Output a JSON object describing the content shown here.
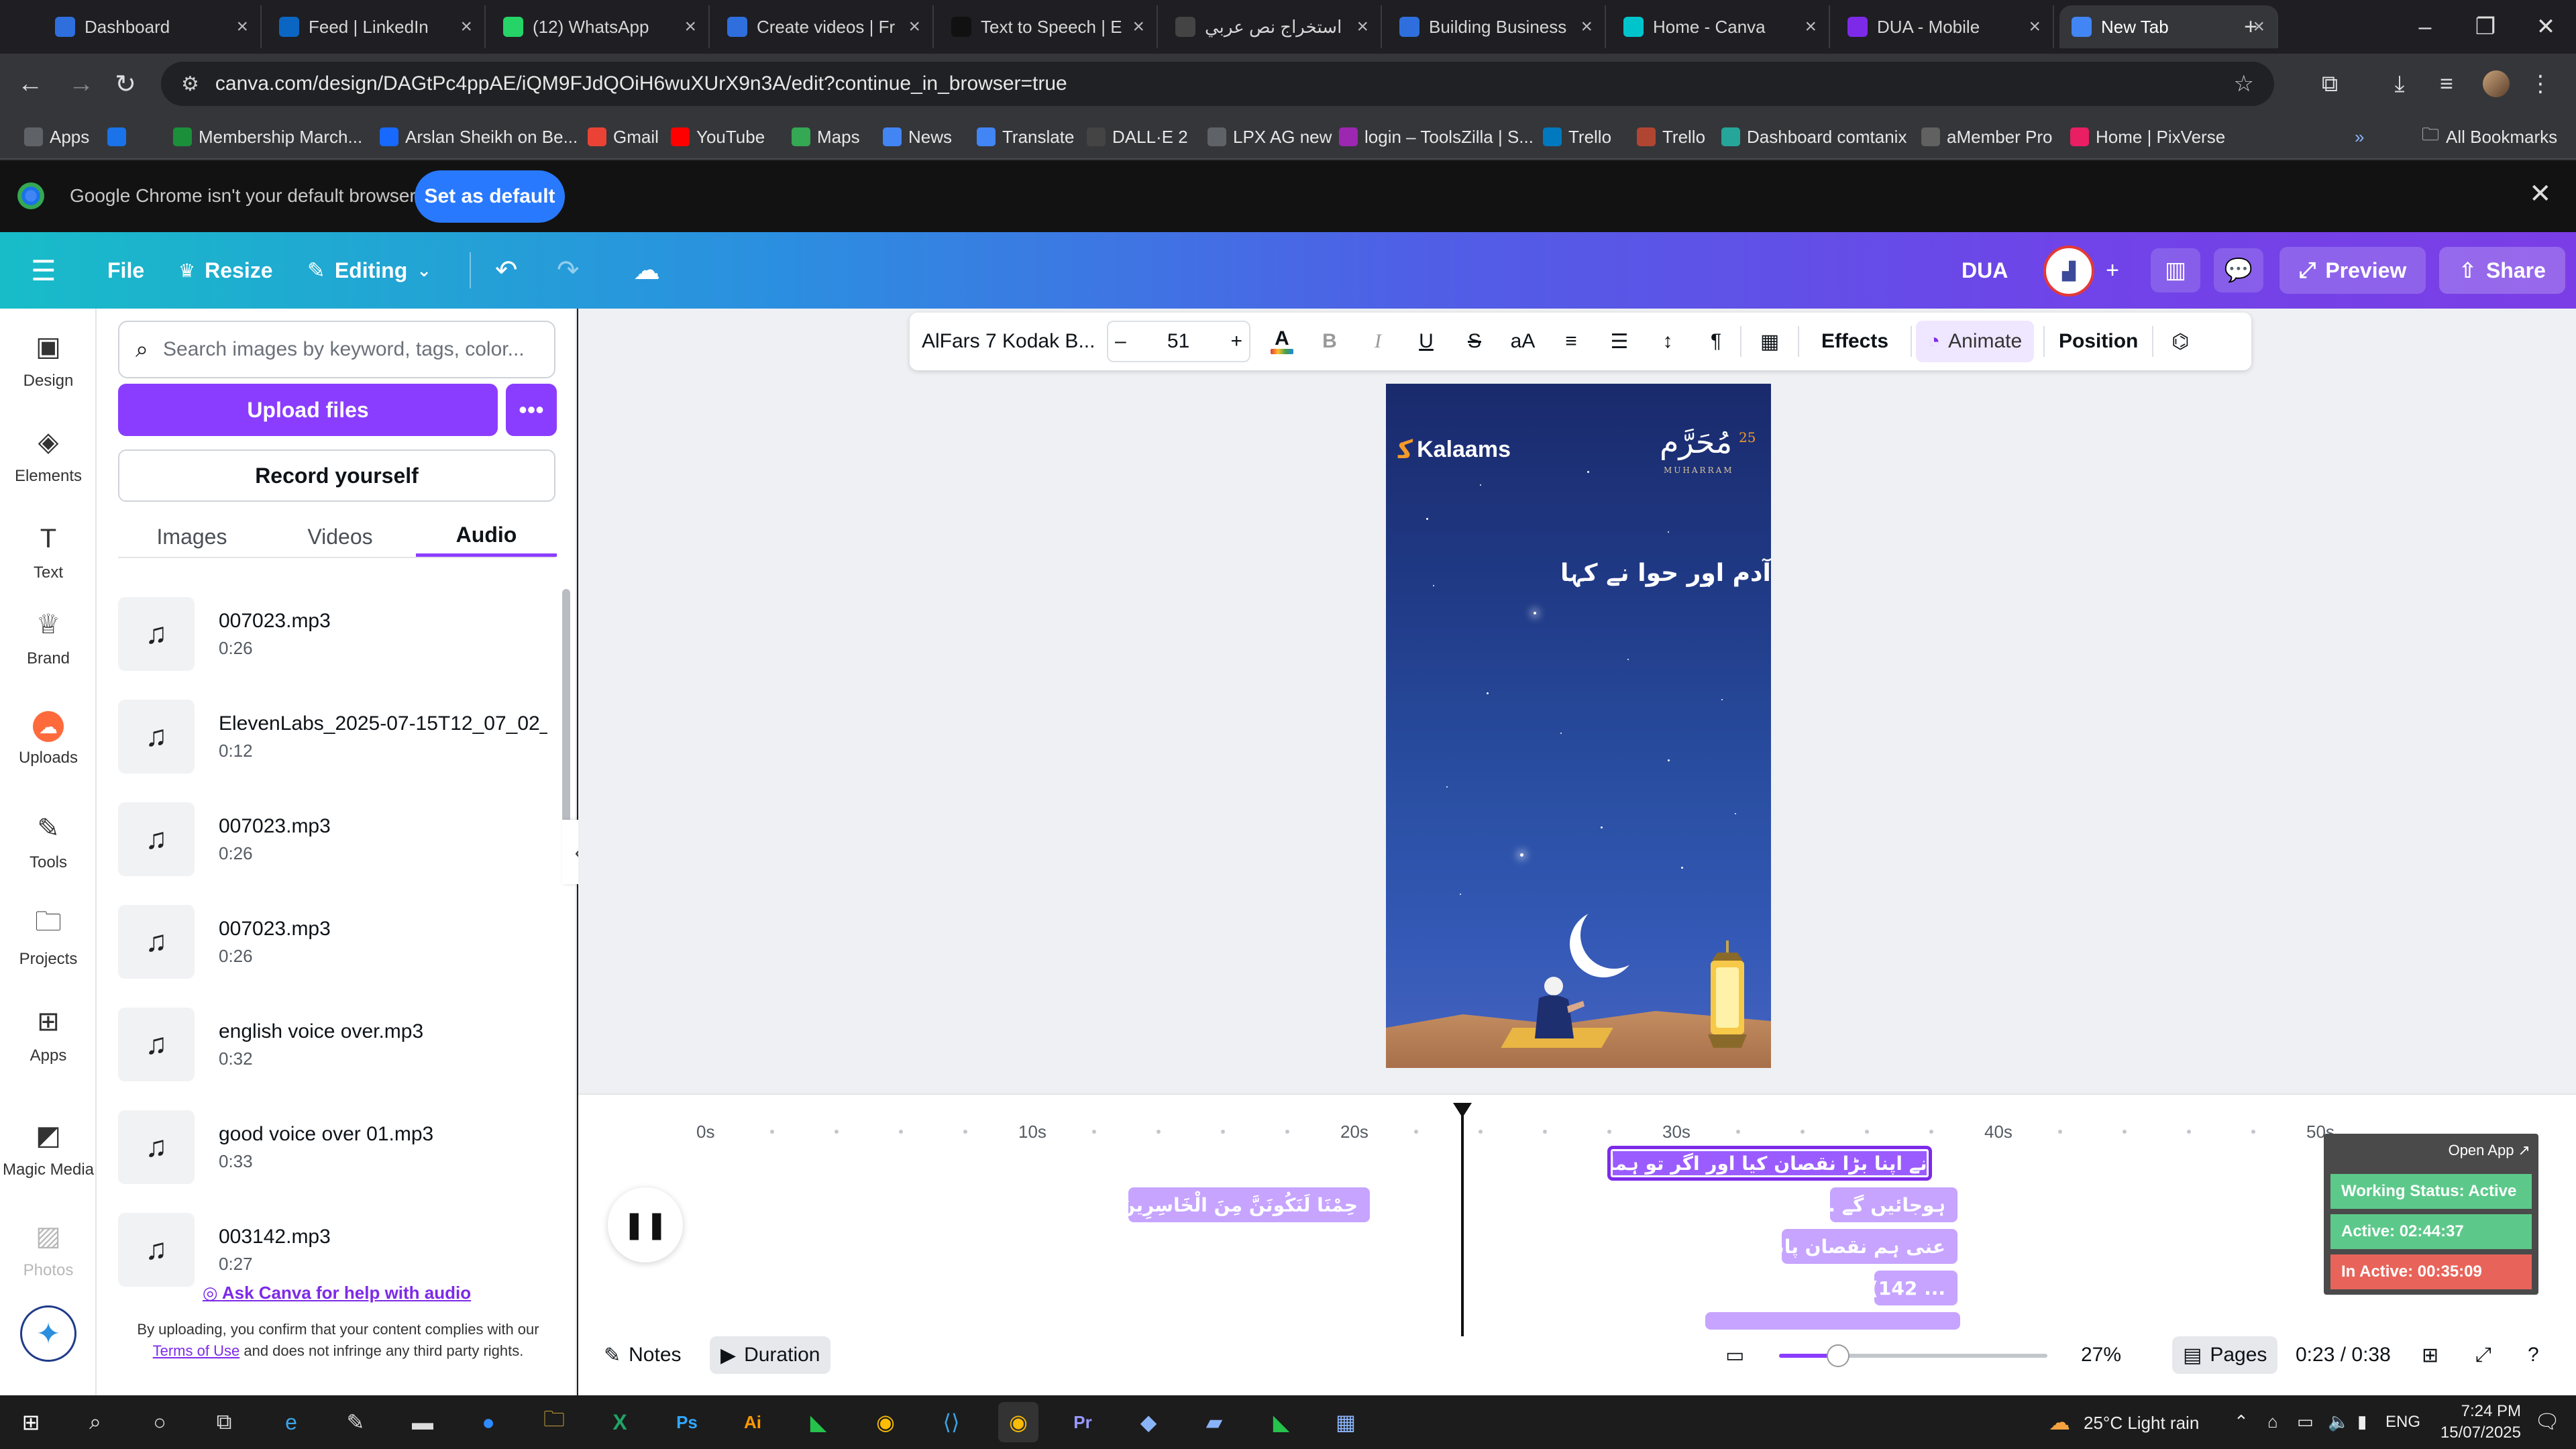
{
  "browser": {
    "tabs": [
      {
        "title": "Dashboard",
        "favicon": "dashboard-icon",
        "color": "#2f6fdd"
      },
      {
        "title": "Feed | LinkedIn",
        "favicon": "linkedin-icon",
        "color": "#0a66c2"
      },
      {
        "title": "(12) WhatsApp",
        "favicon": "whatsapp-icon",
        "color": "#25d366"
      },
      {
        "title": "Create videos | Fr",
        "favicon": "doc-icon",
        "color": "#2f6fdd"
      },
      {
        "title": "Text to Speech | E",
        "favicon": "pause-icon",
        "color": "#111111"
      },
      {
        "title": "استخراج نص عربي",
        "favicon": "openai-icon",
        "color": "#444444"
      },
      {
        "title": "Building Business",
        "favicon": "doc-icon",
        "color": "#2f6fdd"
      },
      {
        "title": "Home - Canva",
        "favicon": "canva-icon",
        "color": "#00c4cc"
      },
      {
        "title": "DUA - Mobile",
        "favicon": "canva-video-icon",
        "color": "#7d2ae8"
      },
      {
        "title": "New Tab",
        "favicon": "chrome-icon",
        "color": "#4285f4"
      }
    ],
    "new_tab_symbol": "+",
    "url": "canva.com/design/DAGtPc4ppAE/iQM9FJdQOiH6wuXUrX9n3A/edit?continue_in_browser=true",
    "bookmarks": [
      {
        "label": "Apps",
        "icon": "apps-grid-icon",
        "color": "#5f6368"
      },
      {
        "label": "",
        "icon": "grid-icon",
        "color": "#1a73e8"
      },
      {
        "label": "Membership March...",
        "icon": "membership-icon",
        "color": "#1b8f3a"
      },
      {
        "label": "Arslan Sheikh on Be...",
        "icon": "behance-icon",
        "color": "#1769ff"
      },
      {
        "label": "Gmail",
        "icon": "gmail-icon",
        "color": "#ea4335"
      },
      {
        "label": "YouTube",
        "icon": "youtube-icon",
        "color": "#ff0000"
      },
      {
        "label": "Maps",
        "icon": "maps-icon",
        "color": "#34a853"
      },
      {
        "label": "News",
        "icon": "news-icon",
        "color": "#4285f4"
      },
      {
        "label": "Translate",
        "icon": "translate-icon",
        "color": "#4285f4"
      },
      {
        "label": "DALL·E 2",
        "icon": "openai-icon",
        "color": "#444444"
      },
      {
        "label": "LPX AG new",
        "icon": "page-icon",
        "color": "#5f6368"
      },
      {
        "label": "login – ToolsZilla | S...",
        "icon": "toolszilla-icon",
        "color": "#9c27b0"
      },
      {
        "label": "Trello",
        "icon": "trello-icon",
        "color": "#0079bf"
      },
      {
        "label": "Trello",
        "icon": "trello-icon",
        "color": "#b04632"
      },
      {
        "label": "Dashboard comtanix",
        "icon": "comtanix-icon",
        "color": "#26a69a"
      },
      {
        "label": "aMember Pro",
        "icon": "amember-icon",
        "color": "#616161"
      },
      {
        "label": "Home | PixVerse",
        "icon": "pixverse-icon",
        "color": "#e91e63"
      }
    ],
    "all_bookmarks": "All Bookmarks",
    "default_msg": "Google Chrome isn't your default browser",
    "set_default": "Set as default"
  },
  "canva_header": {
    "file": "File",
    "resize": "Resize",
    "editing": "Editing",
    "design_title": "DUA",
    "preview": "Preview",
    "share": "Share"
  },
  "rail": [
    {
      "label": "Design",
      "icon": "design-layout-icon"
    },
    {
      "label": "Elements",
      "icon": "elements-shapes-icon"
    },
    {
      "label": "Text",
      "icon": "text-t-icon"
    },
    {
      "label": "Brand",
      "icon": "brand-crown-icon"
    },
    {
      "label": "Uploads",
      "icon": "uploads-cloud-icon"
    },
    {
      "label": "Tools",
      "icon": "tools-pen-icon"
    },
    {
      "label": "Projects",
      "icon": "projects-folder-icon"
    },
    {
      "label": "Apps",
      "icon": "apps-plus-icon"
    },
    {
      "label": "Magic Media",
      "icon": "magic-media-icon"
    },
    {
      "label": "Photos",
      "icon": "photos-icon"
    }
  ],
  "uploads": {
    "search_placeholder": "Search images by keyword, tags, color...",
    "upload_files": "Upload files",
    "more_symbol": "•••",
    "record_yourself": "Record yourself",
    "tabs": [
      "Images",
      "Videos",
      "Audio"
    ],
    "active_tab": "Audio",
    "audio_items": [
      {
        "name": "007023.mp3",
        "duration": "0:26"
      },
      {
        "name": "ElevenLabs_2025-07-15T12_07_02_...",
        "duration": "0:12"
      },
      {
        "name": "007023.mp3",
        "duration": "0:26"
      },
      {
        "name": "007023.mp3",
        "duration": "0:26"
      },
      {
        "name": "english voice over.mp3",
        "duration": "0:32"
      },
      {
        "name": "good voice over 01.mp3",
        "duration": "0:33"
      },
      {
        "name": "003142.mp3",
        "duration": "0:27"
      }
    ],
    "help_link": "Ask Canva for help with audio",
    "disclaimer_a": "By uploading, you confirm that your content complies with our",
    "terms": "Terms of Use",
    "disclaimer_b": "and does not infringe any third party rights."
  },
  "toolbar": {
    "font": "AlFars 7 Kodak B...",
    "minus": "–",
    "font_size": "51",
    "plus": "+",
    "letter_a": "A",
    "bold": "B",
    "italic": "I",
    "underline": "U",
    "strike": "S",
    "case": "aA",
    "effects": "Effects",
    "animate": "Animate",
    "position": "Position"
  },
  "design": {
    "logo_text": "Kalaams",
    "muharram": "مُحَرَّم",
    "muharram_num": "25",
    "muharram_sub": "MUHARRAM",
    "urdu_text": "آدم اور حوا نے کہا"
  },
  "timeline": {
    "ticks": [
      "0s",
      "10s",
      "20s",
      "30s",
      "40s",
      "50s"
    ],
    "clips": [
      {
        "text": "...حِمْنَا لَنَكُونَنَّ مِنَ الْخَاسِرِينَ",
        "selected": false
      },
      {
        "text": "ہم نے اپنا بڑا نقصان کیا اور اگر تو ہماری",
        "selected": true
      },
      {
        "text": "... ہوجائیں گے",
        "selected": false
      },
      {
        "text": "...عنی ہم نقصان پانے",
        "selected": false
      },
      {
        "text": "(142 ...",
        "selected": false
      }
    ]
  },
  "bottombar": {
    "notes": "Notes",
    "duration": "Duration",
    "zoom": "27%",
    "zoom_fraction": 0.22,
    "pages": "Pages",
    "time": "0:23 / 0:38"
  },
  "tracker": {
    "open_app": "Open App ↗",
    "status": "Working Status: Active",
    "active": "Active: 02:44:37",
    "inactive": "In Active: 00:35:09",
    "status_color": "#5cc98a",
    "active_color": "#5cc98a",
    "inactive_color": "#e8645a"
  },
  "taskbar": {
    "weather": "25°C  Light rain",
    "lang": "ENG",
    "time": "7:24 PM",
    "date": "15/07/2025"
  }
}
